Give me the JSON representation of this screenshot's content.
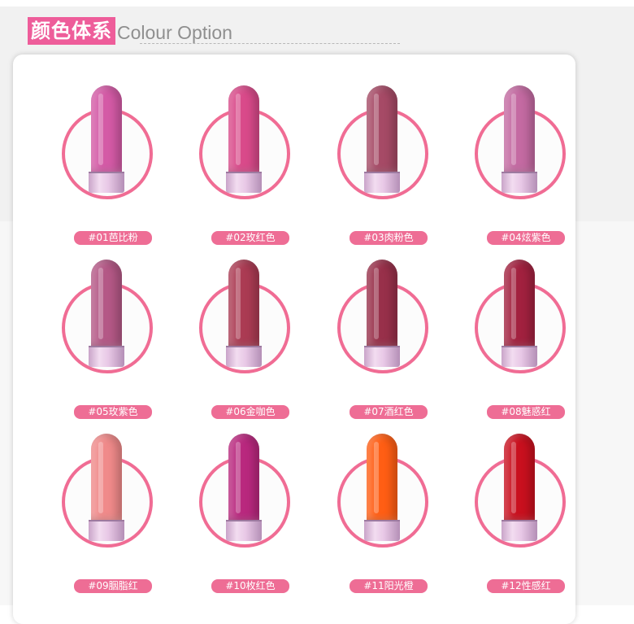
{
  "header": {
    "title_cn": "颜色体系",
    "title_en": "Colour Option"
  },
  "accent_color": "#ee5d9a",
  "ring_color": "#f06c94",
  "swatches": [
    {
      "label": "#01芭比粉",
      "color": "#d45aa6"
    },
    {
      "label": "#02玫红色",
      "color": "#d94a8a"
    },
    {
      "label": "#03肉粉色",
      "color": "#a64a66"
    },
    {
      "label": "#04炫紫色",
      "color": "#c46aa2"
    },
    {
      "label": "#05玫紫色",
      "color": "#b45886"
    },
    {
      "label": "#06金咖色",
      "color": "#ab3b53"
    },
    {
      "label": "#07酒红色",
      "color": "#98304a"
    },
    {
      "label": "#08魅惑红",
      "color": "#a2213f"
    },
    {
      "label": "#09胭脂红",
      "color": "#f08a8a"
    },
    {
      "label": "#10枚红色",
      "color": "#b9287e"
    },
    {
      "label": "#11阳光橙",
      "color": "#ff5e14"
    },
    {
      "label": "#12性感红",
      "color": "#c9101e"
    }
  ]
}
